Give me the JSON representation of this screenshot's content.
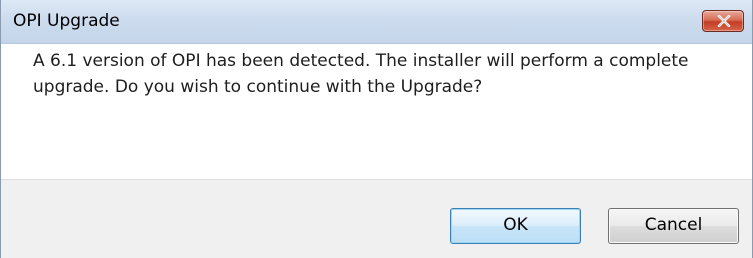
{
  "window": {
    "title": "OPI Upgrade",
    "close_icon": "close-x-icon",
    "close_color": "#c7432a"
  },
  "message": {
    "line1": "A 6.1 version of OPI has been detected.  The installer will perform a complete",
    "line2": "upgrade.  Do you wish to continue with the Upgrade?"
  },
  "buttons": {
    "ok_label": "OK",
    "cancel_label": "Cancel"
  },
  "colors": {
    "titlebar": "#cddcee",
    "button_bar": "#f0f0f0",
    "default_button_border": "#3c7fb1"
  }
}
